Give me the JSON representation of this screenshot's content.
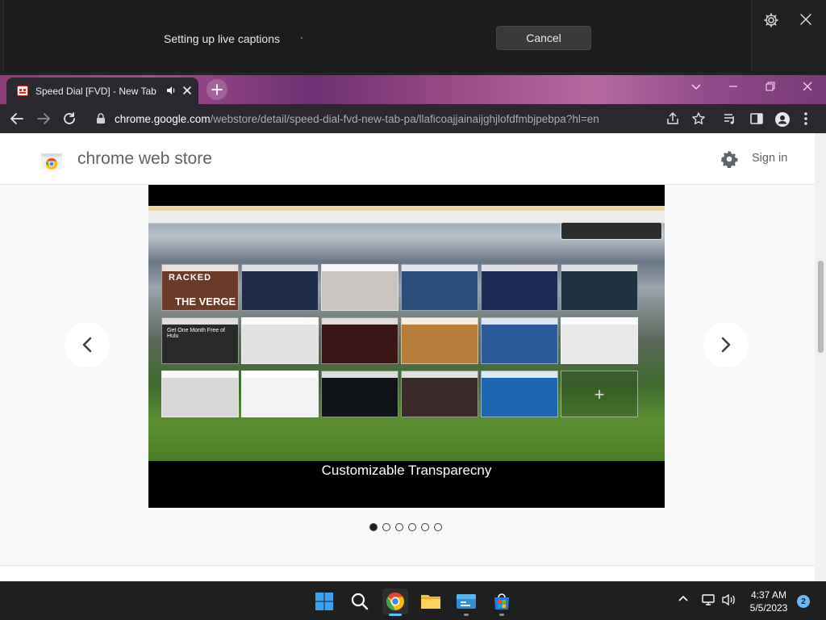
{
  "captions": {
    "status_text": "Setting up live captions",
    "cancel_label": "Cancel",
    "icons": [
      "gear-icon",
      "close-icon"
    ]
  },
  "browser": {
    "tab_title": "Speed Dial [FVD] - New Tab",
    "url_host": "chrome.google.com",
    "url_path": "/webstore/detail/speed-dial-fvd-new-tab-pa/llaficoajjainaijghjlofdfmbjpebpa?hl=en",
    "toolbar_icons": [
      "back-icon",
      "forward-icon",
      "reload-icon",
      "lock-icon",
      "share-icon",
      "star-icon",
      "reading-list-icon",
      "side-panel-icon",
      "profile-icon",
      "more-icon"
    ]
  },
  "store": {
    "title": "chrome web store",
    "sign_in": "Sign in"
  },
  "slideshow": {
    "caption": "Customizable Transparecny",
    "tiles": [
      {
        "line1": "RACKED",
        "line2": "THE VERGE"
      },
      {
        "line1": "",
        "line2": ""
      },
      {
        "line1": "",
        "line2": ""
      },
      {
        "line1": "",
        "line2": ""
      },
      {
        "line1": "",
        "line2": ""
      },
      {
        "line1": "",
        "line2": ""
      },
      {
        "line1": "Get One Month Free of Hulu",
        "line2": ""
      },
      {
        "line1": "",
        "line2": ""
      },
      {
        "line1": "",
        "line2": ""
      },
      {
        "line1": "",
        "line2": ""
      },
      {
        "line1": "",
        "line2": ""
      },
      {
        "line1": "",
        "line2": ""
      },
      {
        "line1": "",
        "line2": ""
      },
      {
        "line1": "",
        "line2": ""
      },
      {
        "line1": "",
        "line2": ""
      },
      {
        "line1": "",
        "line2": ""
      },
      {
        "line1": "",
        "line2": ""
      },
      {
        "line1": "+",
        "line2": ""
      }
    ],
    "dots": 6,
    "active_dot": 0
  },
  "taskbar": {
    "time": "4:37 AM",
    "date": "5/5/2023",
    "notifications": "2",
    "apps": [
      "windows-start-icon",
      "search-icon",
      "chrome-icon",
      "file-explorer-icon",
      "live-captions-icon",
      "microsoft-store-icon"
    ]
  }
}
